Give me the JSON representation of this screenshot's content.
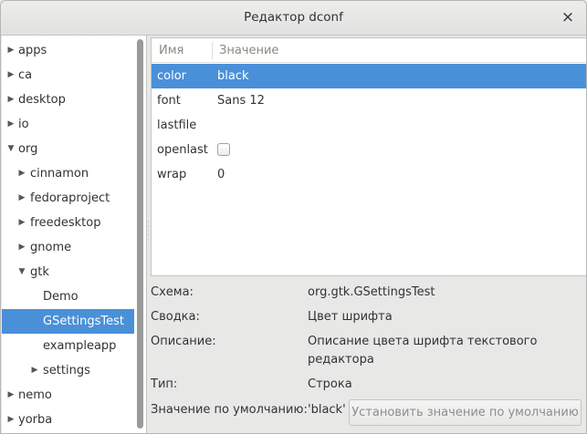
{
  "window": {
    "title": "Редактор dconf",
    "close_glyph": "×"
  },
  "tree": {
    "items": [
      {
        "label": "apps",
        "expanded": false
      },
      {
        "label": "ca",
        "expanded": false
      },
      {
        "label": "desktop",
        "expanded": false
      },
      {
        "label": "io",
        "expanded": false
      },
      {
        "label": "org",
        "expanded": true
      },
      {
        "label": "cinnamon",
        "expanded": false
      },
      {
        "label": "fedoraproject",
        "expanded": false
      },
      {
        "label": "freedesktop",
        "expanded": false
      },
      {
        "label": "gnome",
        "expanded": false
      },
      {
        "label": "gtk",
        "expanded": true
      },
      {
        "label": "Demo"
      },
      {
        "label": "GSettingsTest",
        "selected": true
      },
      {
        "label": "exampleapp"
      },
      {
        "label": "settings",
        "expanded": false
      },
      {
        "label": "nemo",
        "expanded": false
      },
      {
        "label": "yorba",
        "expanded": false
      }
    ]
  },
  "table": {
    "headers": {
      "name": "Имя",
      "value": "Значение"
    },
    "rows": [
      {
        "name": "color",
        "value": "black",
        "selected": true
      },
      {
        "name": "font",
        "value": "Sans 12"
      },
      {
        "name": "lastfile",
        "value": ""
      },
      {
        "name": "openlast",
        "value": "",
        "checkbox": true,
        "checked": false
      },
      {
        "name": "wrap",
        "value": "0"
      }
    ]
  },
  "details": {
    "schema_label": "Схема:",
    "schema_value": "org.gtk.GSettingsTest",
    "summary_label": "Сводка:",
    "summary_value": "Цвет шрифта",
    "description_label": "Описание:",
    "description_value": "Описание цвета шрифта текстового редактора",
    "type_label": "Тип:",
    "type_value": "Строка",
    "default_label": "Значение по умолчанию:",
    "default_value": "'black'",
    "set_default_button": "Установить значение по умолчанию"
  },
  "colors": {
    "selection": "#4a90d9",
    "background": "#e8e8e7"
  }
}
